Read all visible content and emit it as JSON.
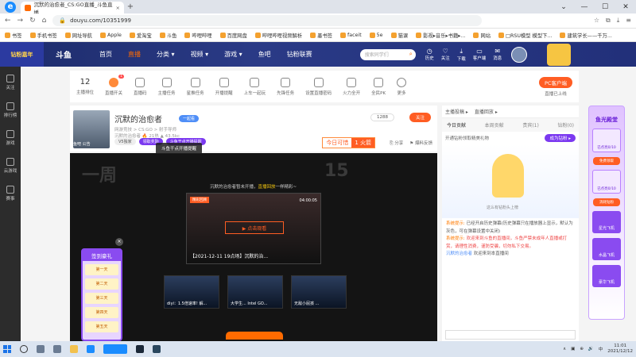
{
  "browser": {
    "logo": "e",
    "tab_title": "沉默的治愈者_CS:GO直播_斗鱼直播",
    "tab_close": "×",
    "new_tab": "+",
    "win_controls": [
      "⌄",
      "—",
      "☐",
      "✕"
    ],
    "nav": [
      "←",
      "→",
      "↻",
      "⌂"
    ],
    "url": "douyu.com/10351999",
    "bookmarks": [
      "书签",
      "手机书签",
      "网址导航",
      "Apple",
      "爱淘宝",
      "斗鱼",
      "哔哩哔哩",
      "百度网盘",
      "哔哩哔哩视频解析",
      "墨书签",
      "faceit",
      "5e",
      "猫课",
      "影视▸音乐▸书籍▸...",
      "网站",
      "□RSU模型 模型下...",
      "建筑学长——千万..."
    ]
  },
  "site": {
    "logo_text": "钻粉嘉年",
    "brand": "斗鱼",
    "nav": [
      "首页",
      "直播",
      "分类 ▾",
      "视频 ▾",
      "游戏 ▾",
      "鱼吧",
      "钻粉联赛"
    ],
    "active_nav": "直播",
    "search_placeholder": "搜索同学们",
    "icons": [
      "历史",
      "关注",
      "下载",
      "客户端",
      "消息"
    ]
  },
  "leftbar": [
    "关注",
    "排行榜",
    "游戏",
    "云游戏",
    "赛事"
  ],
  "toolbar": {
    "level_num": "12",
    "level_label": "主播排位",
    "badge": "1",
    "items": [
      "直播开关",
      "直播码",
      "主播任务",
      "星推任务",
      "开播提醒",
      "上车一起玩",
      "先锋任务",
      "设置直播密码",
      "火力全开",
      "全民PK",
      "更多"
    ],
    "pc_button": "PC客户端",
    "pc_sub": "直播已上线"
  },
  "streamer": {
    "title": "沉默的治愈者",
    "badge": "一起看",
    "report": "举报",
    "meta": "网游竞技 > CS:GO > 射手导师",
    "meta2": "沉默的治愈者   🔥 21热   ▲ 43.5kc",
    "thumb_label": "鱼吧   公告",
    "chips": [
      "V5独家",
      "领取奖励",
      "斗鱼干点开播提醒"
    ],
    "follow_count": "1288",
    "follow": "关注",
    "rank_label": "今日可惜",
    "rank_value": "1 火箭",
    "ops": [
      "分享",
      "爆料反馈"
    ],
    "tooltip": "斗鱼干点开播提醒"
  },
  "player": {
    "big1": "一周",
    "big2": "15",
    "notice_prefix": "沉默的治愈者暂未开播，",
    "notice_highlight": "直播回放",
    "notice_suffix": "一样精彩~",
    "replay_tag": "精彩回顾",
    "replay_time": "04:00:05",
    "play_button": "▶ 点击观看",
    "replay_caption": "【2021-12-11 19点场】沉默的治...",
    "recos": [
      "diyi：1.5倍速率! 解...",
      "大学生... Intel GO...",
      "无敌小屁孩 ..."
    ]
  },
  "signin": {
    "header": "签到豪礼",
    "days": [
      "第一天",
      "第二天",
      "第三天",
      "第四天",
      "第五天"
    ],
    "close": "×"
  },
  "rpanel": {
    "top": [
      "主播投稿 ▸",
      "直播回放 ▸"
    ],
    "tabs": [
      "今日贡献",
      "本周贡献",
      "贵宾(1)",
      "钻粉(0)"
    ],
    "row_left": "开通钻粉领取精美礼物",
    "row_btn": "成为钻粉 ▸",
    "illu_caption": "这么有钻粉头上榜",
    "chat_sys": "系统提示:",
    "chat1": "已经开启历史弹幕(历史弹幕只在播放器上显示，默认为灰色，可在弹幕设置中关闭)",
    "chat2": "欢迎来到斗鱼的直播间，斗鱼严禁未成年人直播或打赏，请理性消费，谨防受骗，切勿私下交易。",
    "chat3_user": "沉默的治愈者",
    "chat3": "欢迎来到本直播间"
  },
  "rad": {
    "header": "鱼光殿堂",
    "box1": "已点亮0/10",
    "box2": "已点亮0/10",
    "btn1": "免费领取",
    "btn2": "消耗钻粉",
    "plane1": "星光飞机",
    "plane2": "水晶飞机",
    "plane3": "豪华飞机"
  },
  "taskbar": {
    "time": "11:01",
    "date": "2021/12/12",
    "tray": [
      "∧",
      "▣",
      "⊕",
      "🔊",
      "中"
    ]
  }
}
